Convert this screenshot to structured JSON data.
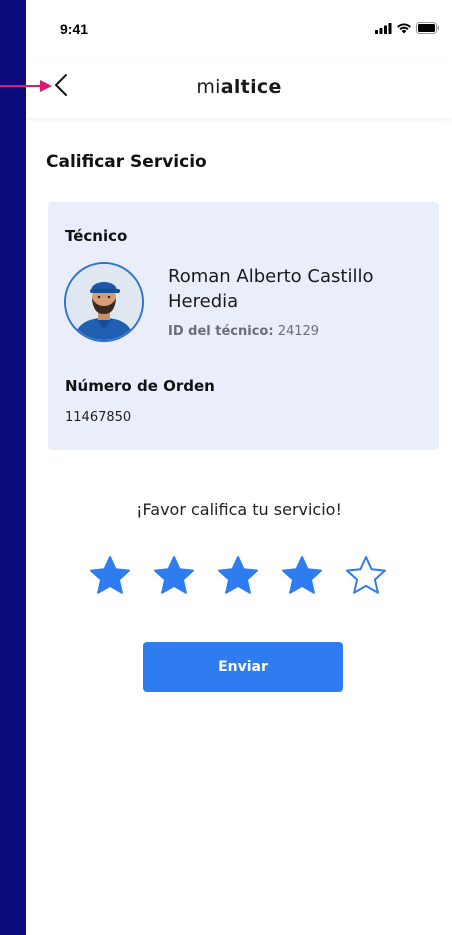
{
  "status_bar": {
    "time": "9:41"
  },
  "header": {
    "brand_prefix": "mi",
    "brand_main": "altice"
  },
  "section_title": "Calificar Servicio",
  "technician": {
    "label": "Técnico",
    "name": "Roman Alberto Castillo Heredia",
    "id_label": "ID del técnico:",
    "id_value": "24129"
  },
  "order": {
    "label": "Número de Orden",
    "value": "11467850"
  },
  "rating": {
    "prompt": "¡Favor califica tu servicio!",
    "value": 4,
    "max": 5
  },
  "submit_label": "Enviar",
  "colors": {
    "accent": "#2f7cf0",
    "card_bg": "#eaeefa",
    "annotation_arrow": "#e0186f"
  }
}
